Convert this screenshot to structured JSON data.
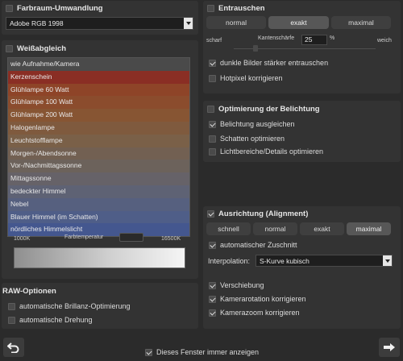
{
  "farbraum": {
    "title": "Farbraum-Umwandlung",
    "selected": "Adobe RGB 1998"
  },
  "weissabgleich": {
    "title": "Weißabgleich",
    "items": [
      {
        "label": "wie Aufnahme/Kamera",
        "color": "#4a4a4a"
      },
      {
        "label": "Kerzenschein",
        "color": "#8a2e24"
      },
      {
        "label": "Glühlampe 60 Watt",
        "color": "#8e4428"
      },
      {
        "label": "Glühlampe 100 Watt",
        "color": "#8b4c2d"
      },
      {
        "label": "Glühlampe 200 Watt",
        "color": "#875533"
      },
      {
        "label": "Halogenlampe",
        "color": "#7f5a3e"
      },
      {
        "label": "Leuchtstofflampe",
        "color": "#7a6048"
      },
      {
        "label": "Morgen-/Abendsonne",
        "color": "#726052"
      },
      {
        "label": "Vor-/Nachmittagssonne",
        "color": "#6c625b"
      },
      {
        "label": "Mittagssonne",
        "color": "#666268"
      },
      {
        "label": "bedeckter Himmel",
        "color": "#5e6274"
      },
      {
        "label": "Nebel",
        "color": "#56607f"
      },
      {
        "label": "Blauer Himmel (im Schatten)",
        "color": "#4f5e88"
      },
      {
        "label": "nördliches Himmelslicht",
        "color": "#44578f"
      }
    ],
    "temp_min": "1000K",
    "temp_label": "Farbtemperatur",
    "temp_max": "16500K"
  },
  "raw": {
    "title": "RAW-Optionen",
    "opt1": "automatische Brillanz-Optimierung",
    "opt2": "automatische Drehung"
  },
  "entrauschen": {
    "title": "Entrauschen",
    "modes": [
      "normal",
      "exakt",
      "maximal"
    ],
    "active_mode": "exakt",
    "scharf": "scharf",
    "kanten_label": "Kantenschärfe",
    "kanten_value": "25",
    "kanten_unit": "%",
    "weich": "weich",
    "opt1": "dunkle Bilder stärker entrauschen",
    "opt2": "Hotpixel korrigieren"
  },
  "belichtung": {
    "title": "Optimierung der Belichtung",
    "opt1": "Belichtung ausgleichen",
    "opt2": "Schatten optimieren",
    "opt3": "Lichtbereiche/Details optimieren"
  },
  "ausrichtung": {
    "title": "Ausrichtung (Alignment)",
    "modes": [
      "schnell",
      "normal",
      "exakt",
      "maximal"
    ],
    "active_mode": "maximal",
    "zuschnitt": "automatischer Zuschnitt",
    "interp_label": "Interpolation:",
    "interp_value": "S-Kurve kubisch",
    "opt1": "Verschiebung",
    "opt2": "Kamerarotation korrigieren",
    "opt3": "Kamerazoom korrigieren"
  },
  "footer": {
    "show_always": "Dieses Fenster immer anzeigen"
  }
}
